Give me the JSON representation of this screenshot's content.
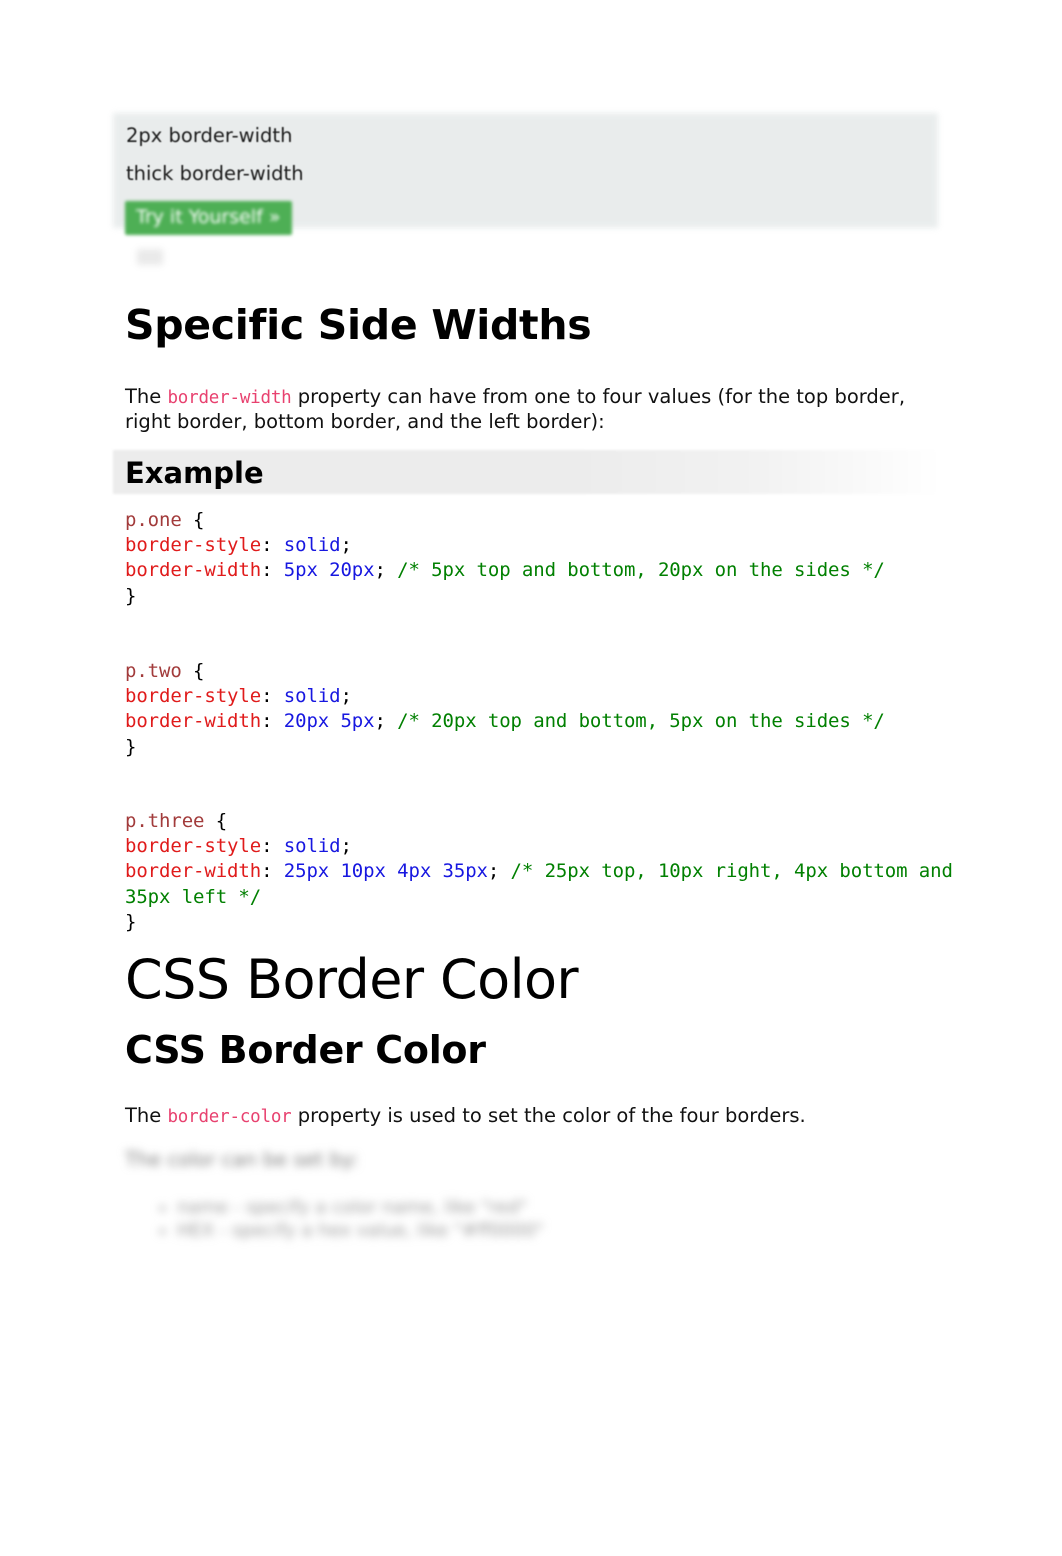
{
  "preview": {
    "line_1": "2px border-width",
    "line_2": "thick border-width",
    "try_it_button": "Try it Yourself »"
  },
  "section": {
    "title": "Specific Side Widths",
    "paragraph_prefix": "The ",
    "paragraph_code": "border-width",
    "paragraph_suffix": " property can have from one to four values (for the top border, right border, bottom border, and the left border):"
  },
  "example": {
    "label": "Example",
    "blocks": [
      {
        "selector": "p.one",
        "open_brace": " {",
        "lines": [
          {
            "property": "border-style",
            "colon": ": ",
            "value": "solid",
            "semicolon": ";",
            "comment": ""
          },
          {
            "property": "border-width",
            "colon": ": ",
            "value": "5px 20px",
            "semicolon": ";",
            "comment": " /* 5px top and bottom, 20px on the sides */"
          }
        ],
        "close_brace": "}"
      },
      {
        "selector": "p.two",
        "open_brace": " {",
        "lines": [
          {
            "property": "border-style",
            "colon": ": ",
            "value": "solid",
            "semicolon": ";",
            "comment": ""
          },
          {
            "property": "border-width",
            "colon": ": ",
            "value": "20px 5px",
            "semicolon": ";",
            "comment": " /* 20px top and bottom, 5px on the sides */"
          }
        ],
        "close_brace": "}"
      },
      {
        "selector": "p.three",
        "open_brace": " {",
        "lines": [
          {
            "property": "border-style",
            "colon": ": ",
            "value": "solid",
            "semicolon": ";",
            "comment": ""
          },
          {
            "property": "border-width",
            "colon": ": ",
            "value": "25px 10px 4px 35px",
            "semicolon": ";",
            "comment": " /* 25px top, 10px right, 4px bottom and 35px left */"
          }
        ],
        "close_brace": "}"
      }
    ]
  },
  "border_color": {
    "page_title": "CSS Border Color",
    "sub_title": "CSS Border Color",
    "paragraph_prefix": "The ",
    "paragraph_code": "border-color",
    "paragraph_suffix": " property is used to set the color of the four borders."
  },
  "trailing": {
    "lead": "The color can be set by:",
    "items": [
      "name - specify a color name, like \"red\"",
      "HEX - specify a hex value, like \"#ff0000\""
    ]
  },
  "colors": {
    "panel_background": "#e8ecec",
    "try_it_green": "#4eaf55",
    "inline_code_pink": "#e8416f",
    "code_selector": "#a23b3b",
    "code_property": "#e01b1b",
    "code_value": "#1717e0",
    "code_comment": "#018001",
    "example_band": "#ececec"
  }
}
